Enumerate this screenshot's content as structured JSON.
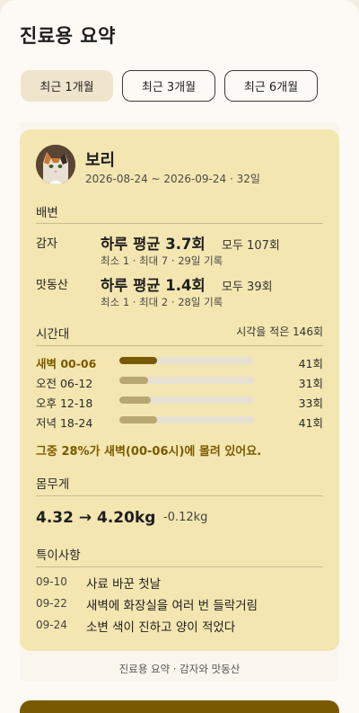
{
  "page": {
    "title": "진료용 요약"
  },
  "tabs": [
    {
      "label": "최근 1개월",
      "active": true
    },
    {
      "label": "최근 3개월",
      "active": false
    },
    {
      "label": "최근 6개월",
      "active": false
    }
  ],
  "pet": {
    "name": "보리",
    "range": "2026-08-24 ~ 2026-09-24 · 32일",
    "avatar_icon": "cat-photo"
  },
  "excretion": {
    "title": "배변",
    "rows": [
      {
        "label": "감자",
        "main": "하루 평균 3.7회",
        "total": "모두 107회",
        "sub": "최소 1 · 최대 7 · 29일 기록"
      },
      {
        "label": "맛동산",
        "main": "하루 평균 1.4회",
        "total": "모두 39회",
        "sub": "최소 1 · 최대 2 · 28일 기록"
      }
    ]
  },
  "time_of_day": {
    "title": "시간대",
    "note": "시각을 적은 146회",
    "bars": [
      {
        "label": "새벽 00-06",
        "count": "41회",
        "fraction": 0.28,
        "highlight": true
      },
      {
        "label": "오전 06-12",
        "count": "31회",
        "fraction": 0.21,
        "highlight": false
      },
      {
        "label": "오후 12-18",
        "count": "33회",
        "fraction": 0.23,
        "highlight": false
      },
      {
        "label": "저녁 18-24",
        "count": "41회",
        "fraction": 0.28,
        "highlight": false
      }
    ],
    "insight": "그중 28%가 새벽(00-06시)에 몰려 있어요."
  },
  "weight": {
    "title": "몸무게",
    "value": "4.32 → 4.20kg",
    "delta": "-0.12kg"
  },
  "notes": {
    "title": "특이사항",
    "items": [
      {
        "date": "09-10",
        "text": "사료 바꾼 첫날"
      },
      {
        "date": "09-22",
        "text": "새벽에 화장실을 여러 번 들락거림"
      },
      {
        "date": "09-24",
        "text": "소변 색이 진하고 양이 적었다"
      }
    ]
  },
  "footer": {
    "caption": "진료용 요약 · 감자와 맛동산"
  },
  "colors": {
    "accent": "#7a5a00",
    "card": "#f4e6b0",
    "tab_active": "#efe5cc"
  }
}
